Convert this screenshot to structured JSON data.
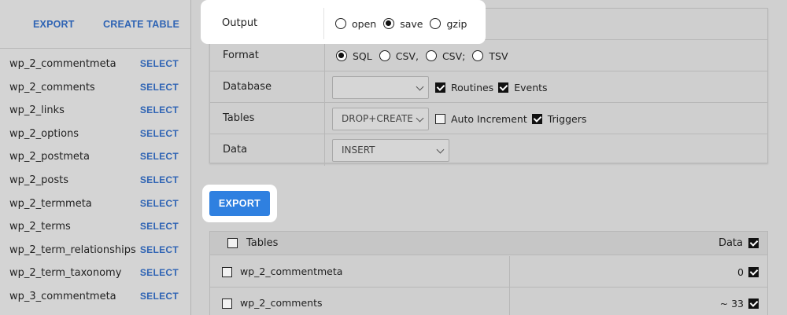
{
  "sidebar": {
    "export_label": "EXPORT",
    "create_table_label": "CREATE TABLE",
    "select_label": "SELECT",
    "tables": [
      "wp_2_commentmeta",
      "wp_2_comments",
      "wp_2_links",
      "wp_2_options",
      "wp_2_postmeta",
      "wp_2_posts",
      "wp_2_termmeta",
      "wp_2_terms",
      "wp_2_term_relationships",
      "wp_2_term_taxonomy",
      "wp_3_commentmeta"
    ]
  },
  "options": {
    "output": {
      "label": "Output",
      "choices": [
        {
          "label": "open",
          "checked": false
        },
        {
          "label": "save",
          "checked": true
        },
        {
          "label": "gzip",
          "checked": false
        }
      ]
    },
    "format": {
      "label": "Format",
      "choices": [
        {
          "label": "SQL",
          "checked": true
        },
        {
          "label": "CSV,",
          "checked": false
        },
        {
          "label": "CSV;",
          "checked": false
        },
        {
          "label": "TSV",
          "checked": false
        }
      ]
    },
    "database": {
      "label": "Database",
      "select_value": "",
      "routines_label": "Routines",
      "routines_checked": true,
      "events_label": "Events",
      "events_checked": true
    },
    "tables": {
      "label": "Tables",
      "select_value": "DROP+CREATE",
      "auto_increment_label": "Auto Increment",
      "auto_increment_checked": false,
      "triggers_label": "Triggers",
      "triggers_checked": true
    },
    "data": {
      "label": "Data",
      "select_value": "INSERT"
    }
  },
  "export_button_label": "EXPORT",
  "table_list": {
    "header_tables_label": "Tables",
    "header_data_label": "Data",
    "header_tables_checked": false,
    "header_data_checked": true,
    "rows": [
      {
        "name": "wp_2_commentmeta",
        "count": "0",
        "table_checked": false,
        "data_checked": true
      },
      {
        "name": "wp_2_comments",
        "count": "~ 33",
        "table_checked": false,
        "data_checked": true
      }
    ]
  },
  "colors": {
    "link_blue": "#2f64b4",
    "button_blue": "#2f80e0"
  }
}
